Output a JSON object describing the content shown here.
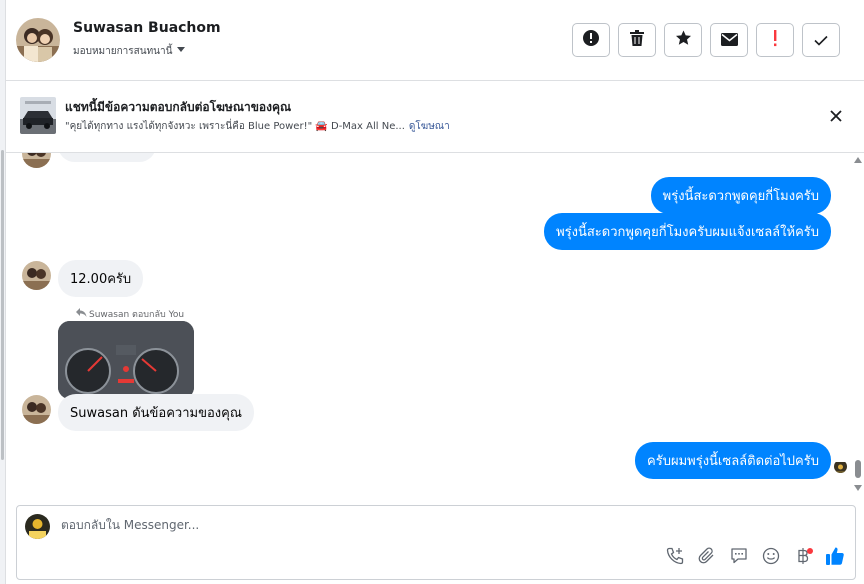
{
  "header": {
    "name": "Suwasan Buachom",
    "assign_label": "มอบหมายการสนทนานี้",
    "actions": [
      {
        "icon": "alert-circle-icon"
      },
      {
        "icon": "trash-icon"
      },
      {
        "icon": "star-icon"
      },
      {
        "icon": "mail-icon"
      },
      {
        "icon": "exclamation-icon"
      },
      {
        "icon": "check-icon"
      }
    ]
  },
  "banner": {
    "title": "แชทนี้มีข้อความตอบกลับต่อโฆษณาของคุณ",
    "subtitle": "\"คุยได้ทุกทาง แรงได้ทุกจังหวะ เพราะนี่คือ Blue Power!\" 🚘 D-Max All Ne...",
    "link": "ดูโฆษณา"
  },
  "messages": {
    "out1": "พรุ่งนี้สะดวกพูดคุยกี่โมงครับ",
    "out2": "พรุ่งนี้สะดวกพูดคุยกี่โมงครับผมแจ้งเซลล์ให้ครับ",
    "in1": "12.00ครับ",
    "reply_hint": "Suwasan ตอบกลับ You",
    "in2": "Suwasan ดันข้อความของคุณ",
    "out3": "ครับผมพรุ่งนี้เซลล์ติดต่อไปครับ"
  },
  "composer": {
    "placeholder": "ตอบกลับใน Messenger..."
  },
  "colors": {
    "accent": "#0084ff",
    "bubble_in": "#f0f2f5",
    "alert": "#fa383e"
  }
}
